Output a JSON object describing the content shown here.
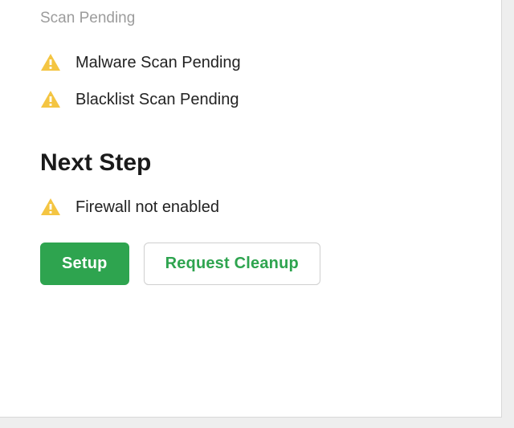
{
  "status": {
    "subtitle": "Scan Pending",
    "items": [
      {
        "label": "Malware Scan Pending"
      },
      {
        "label": "Blacklist Scan Pending"
      }
    ]
  },
  "next_step": {
    "heading": "Next Step",
    "firewall_label": "Firewall not enabled"
  },
  "buttons": {
    "setup": "Setup",
    "request_cleanup": "Request Cleanup"
  },
  "colors": {
    "warning": "#f4c542",
    "primary": "#2ea44f"
  }
}
